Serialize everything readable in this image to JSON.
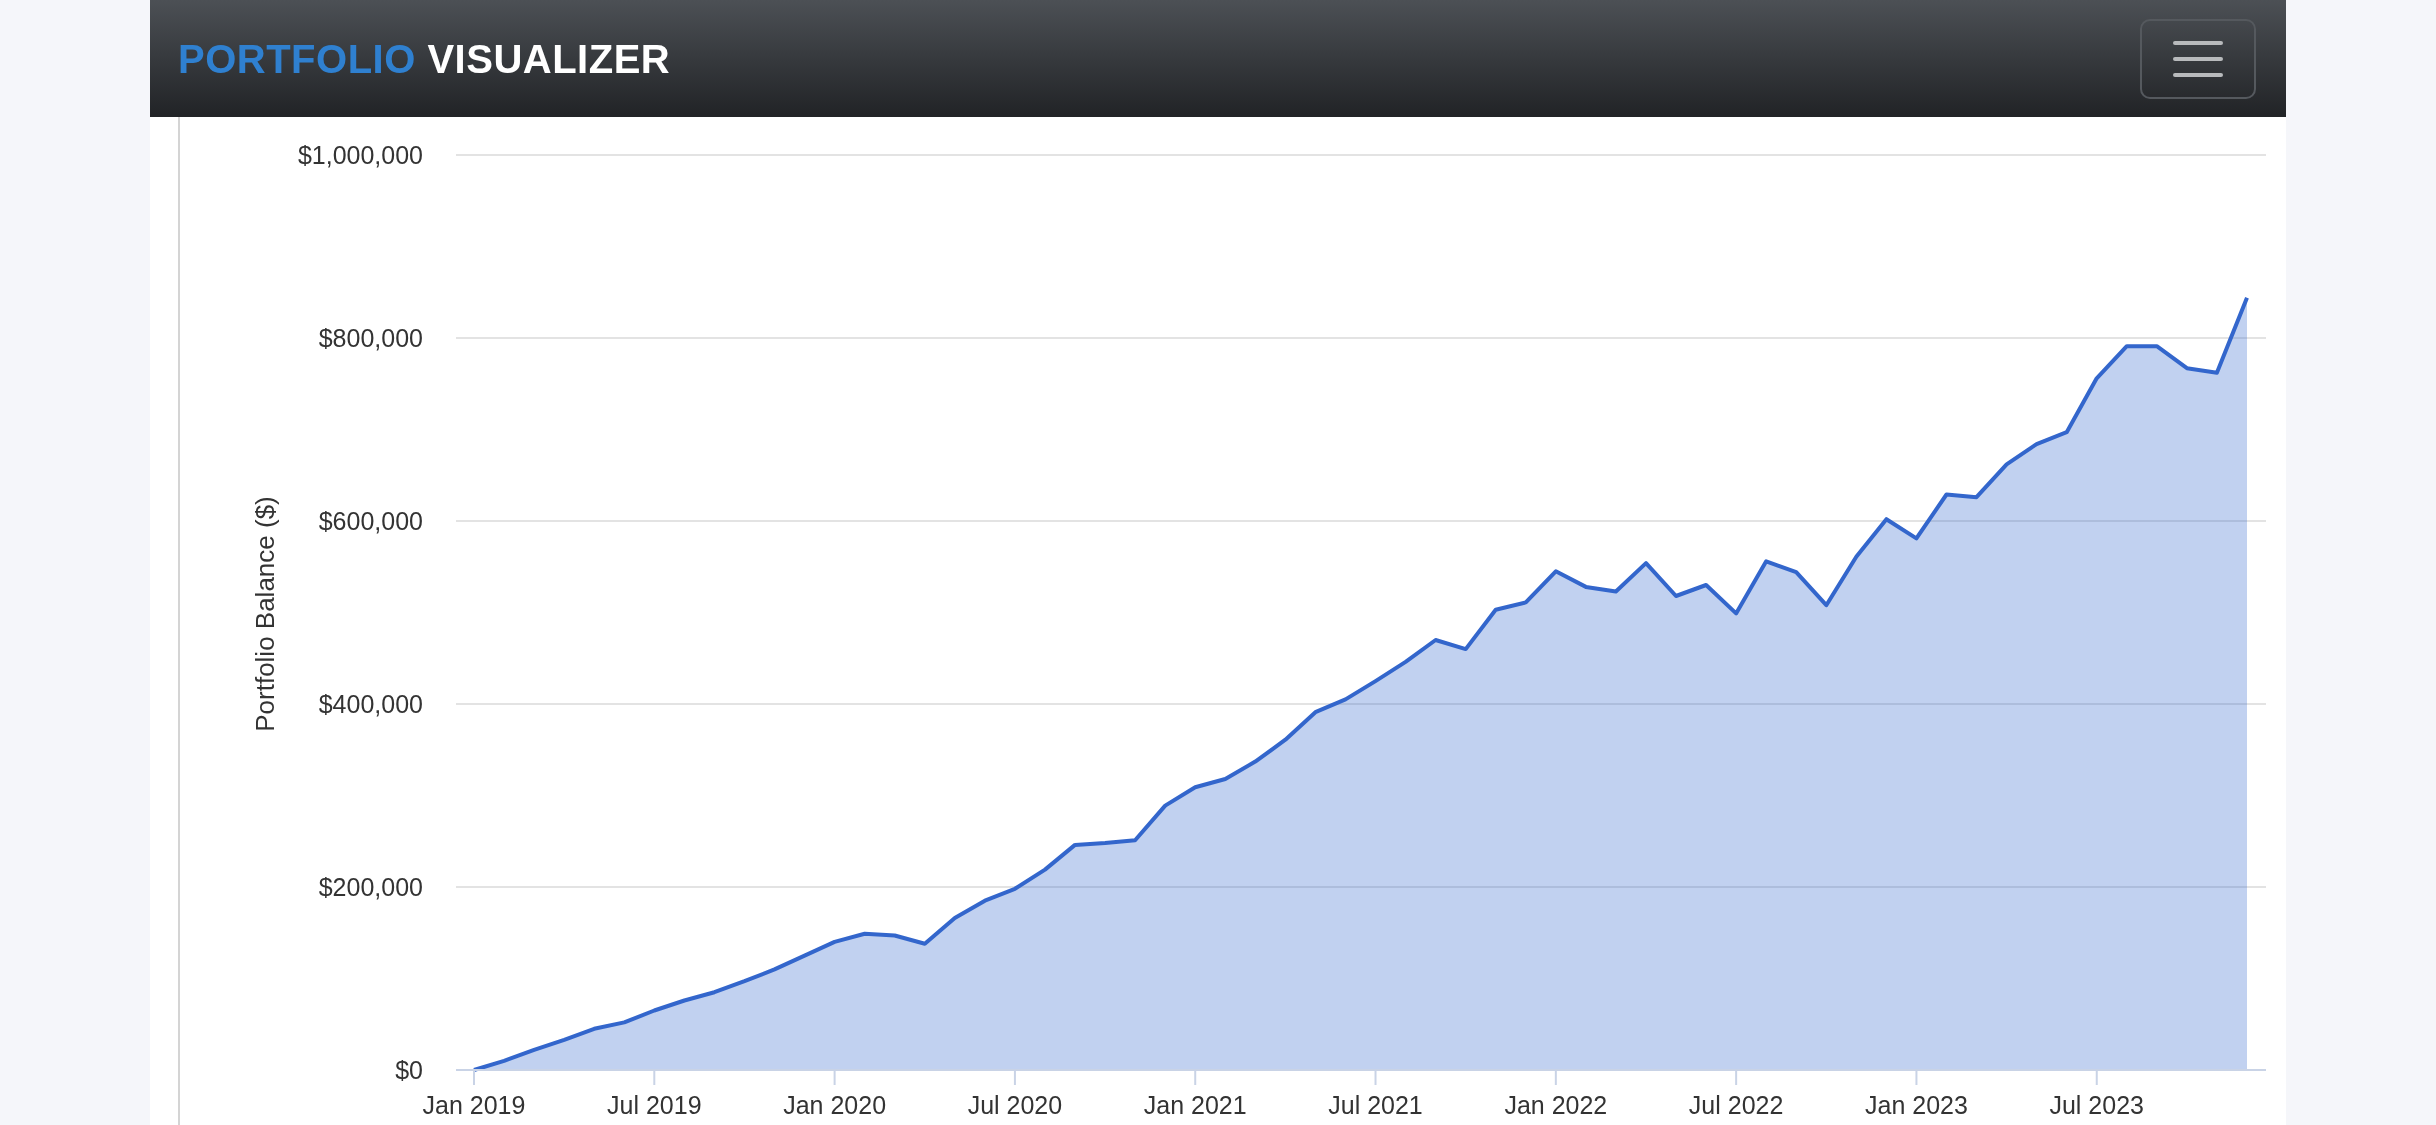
{
  "navbar": {
    "brand": [
      {
        "text": "PORTFOLIO",
        "kind": "accent"
      },
      {
        "text": "VISUALIZER",
        "kind": "plain"
      }
    ]
  },
  "chart_data": {
    "type": "area",
    "ylabel": "Portfolio Balance ($)",
    "categories": [
      "Jan 2019",
      null,
      null,
      null,
      null,
      null,
      "Jul 2019",
      null,
      null,
      null,
      null,
      null,
      "Jan 2020",
      null,
      null,
      null,
      null,
      null,
      "Jul 2020",
      null,
      null,
      null,
      null,
      null,
      "Jan 2021",
      null,
      null,
      null,
      null,
      null,
      "Jul 2021",
      null,
      null,
      null,
      null,
      null,
      "Jan 2022",
      null,
      null,
      null,
      null,
      null,
      "Jul 2022",
      null,
      null,
      null,
      null,
      null,
      "Jan 2023",
      null,
      null,
      null,
      null,
      null,
      "Jul 2023",
      null,
      null,
      null,
      null,
      null
    ],
    "series": [
      {
        "color": "#3366cc",
        "values": [
          0,
          10000,
          22000,
          33000,
          45000,
          52000,
          65000,
          76000,
          85000,
          97000,
          110000,
          125000,
          140000,
          149000,
          147000,
          138000,
          166000,
          185000,
          198000,
          219000,
          246000,
          248000,
          251000,
          289000,
          309000,
          318000,
          337000,
          361000,
          391000,
          405000,
          425000,
          446000,
          470000,
          460000,
          503000,
          511000,
          545000,
          528000,
          523000,
          554000,
          518000,
          530000,
          499000,
          556000,
          544000,
          508000,
          561000,
          602000,
          581000,
          629000,
          626000,
          662000,
          684000,
          697000,
          756000,
          791000,
          791000,
          767000,
          762000,
          844000
        ]
      }
    ],
    "ylim": [
      0,
      1000000
    ],
    "grid": true,
    "yticks": [
      {
        "value": 0,
        "label": "$0"
      },
      {
        "value": 200000,
        "label": "$200,000"
      },
      {
        "value": 400000,
        "label": "$400,000"
      },
      {
        "value": 600000,
        "label": "$600,000"
      },
      {
        "value": 800000,
        "label": "$800,000"
      },
      {
        "value": 1000000,
        "label": "$1,000,000"
      }
    ]
  }
}
